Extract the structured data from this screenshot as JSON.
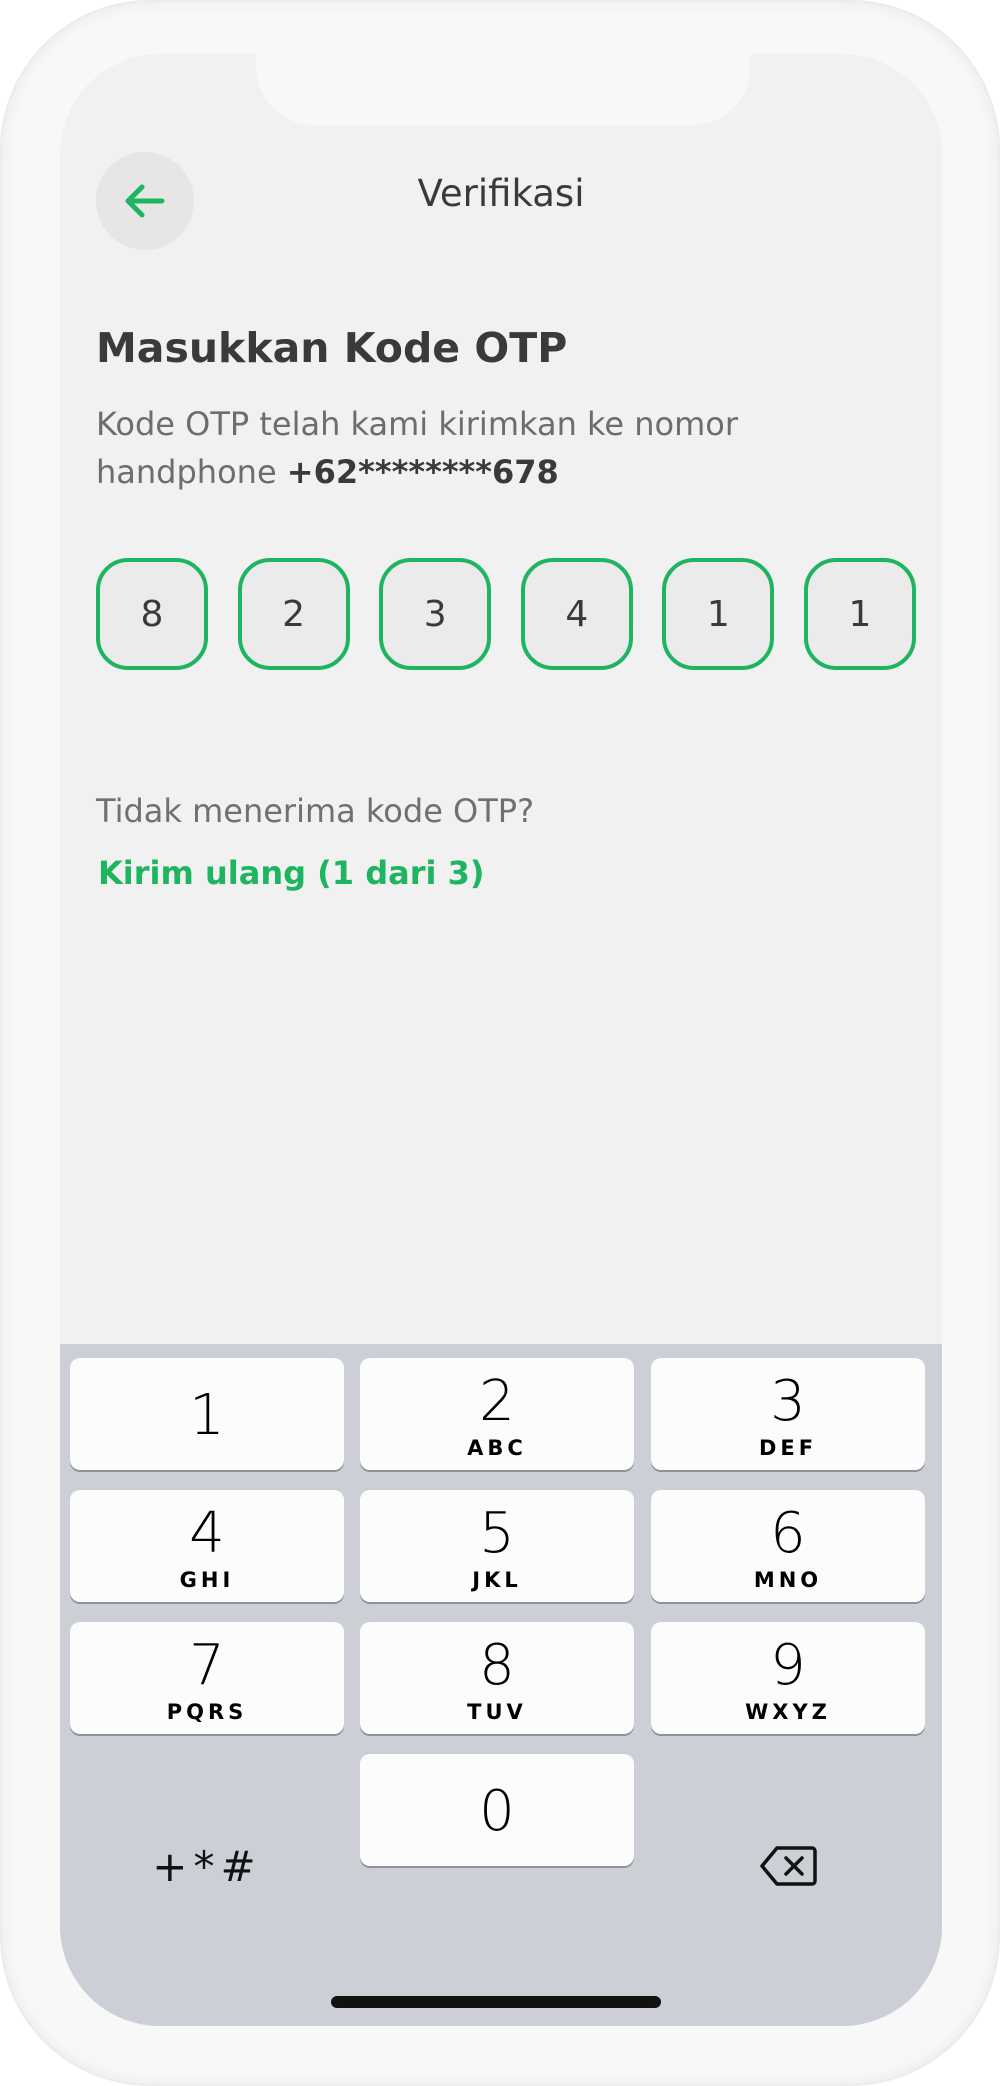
{
  "header": {
    "title": "Verifikasi",
    "back_icon": "arrow-left-icon",
    "accent_color": "#1fb45f"
  },
  "main": {
    "heading": "Masukkan Kode OTP",
    "description": "Kode OTP telah kami kirimkan ke nomor handphone",
    "phone_number": "+62********678",
    "otp_digits": [
      "8",
      "2",
      "3",
      "4",
      "1",
      "1"
    ],
    "not_received_text": "Tidak menerima kode OTP?",
    "resend_label": "Kirim ulang (1 dari 3)"
  },
  "keypad": {
    "keys": [
      {
        "num": "1",
        "letters": ""
      },
      {
        "num": "2",
        "letters": "ABC"
      },
      {
        "num": "3",
        "letters": "DEF"
      },
      {
        "num": "4",
        "letters": "GHI"
      },
      {
        "num": "5",
        "letters": "JKL"
      },
      {
        "num": "6",
        "letters": "MNO"
      },
      {
        "num": "7",
        "letters": "PQRS"
      },
      {
        "num": "8",
        "letters": "TUV"
      },
      {
        "num": "9",
        "letters": "WXYZ"
      },
      {
        "num": "0",
        "letters": ""
      }
    ],
    "symbols_label": "+*#",
    "delete_icon": "backspace-icon"
  }
}
